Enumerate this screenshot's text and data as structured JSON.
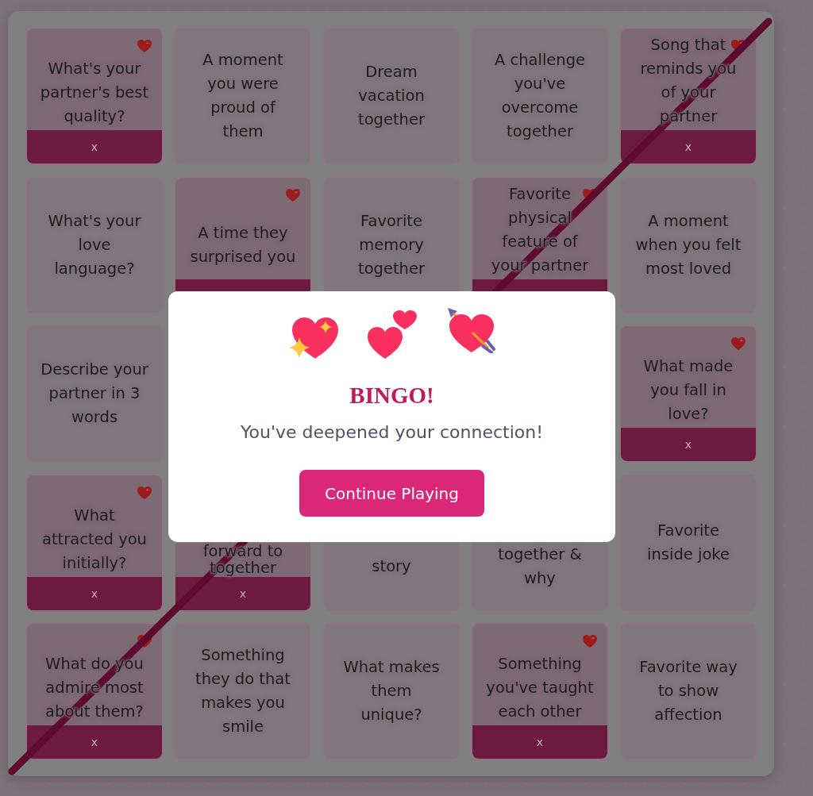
{
  "board": {
    "winning_line": {
      "kind": "anti_diagonal"
    },
    "rows": [
      {
        "cells": [
          {
            "kind": "card",
            "text": "What's your\npartner's best\nquality?",
            "marked": true,
            "remove_label": "x"
          },
          {
            "kind": "card",
            "text": "A moment\nyou were\nproud of\nthem",
            "marked": false
          },
          {
            "kind": "card",
            "text": "Dream\nvacation\ntogether",
            "marked": false
          },
          {
            "kind": "card",
            "text": "A challenge\nyou've\novercome\ntogether",
            "marked": false
          },
          {
            "kind": "card",
            "text": "Song that\nreminds you\nof your\npartner",
            "marked": true,
            "remove_label": "x"
          }
        ]
      },
      {
        "cells": [
          {
            "kind": "card",
            "text": "What's your\nlove\nlanguage?",
            "marked": false
          },
          {
            "kind": "card",
            "text": "A time they\nsurprised you",
            "marked": true
          },
          {
            "kind": "card",
            "text": "Favorite\nmemory\ntogether",
            "marked": false
          },
          {
            "kind": "card",
            "text": "Favorite\nphysical\nfeature of\nyour partner",
            "marked": true
          },
          {
            "kind": "card",
            "text": "A moment\nwhen you felt\nmost loved",
            "marked": false
          }
        ]
      },
      {
        "cells": [
          {
            "kind": "card",
            "text": "Describe your\npartner in 3\nwords",
            "marked": false
          },
          {
            "kind": "covered"
          },
          {
            "kind": "covered"
          },
          {
            "kind": "covered"
          },
          {
            "kind": "card",
            "text": "What made\nyou fall in\nlove?",
            "marked": true,
            "remove_label": "x"
          }
        ]
      },
      {
        "cells": [
          {
            "kind": "card",
            "text": "What\nattracted you\ninitially?",
            "marked": true,
            "remove_label": "x"
          },
          {
            "kind": "cut",
            "text": "forward to\ntogether",
            "marked": true,
            "remove_label": "x"
          },
          {
            "kind": "cut",
            "text": "story",
            "marked": false
          },
          {
            "kind": "cut",
            "text": "together &\nwhy",
            "marked": false
          },
          {
            "kind": "card",
            "text": "Favorite\ninside joke",
            "marked": false
          }
        ]
      },
      {
        "cells": [
          {
            "kind": "card",
            "text": "What do you\nadmire most\nabout them?",
            "marked": true,
            "remove_label": "x"
          },
          {
            "kind": "card",
            "text": "Something\nthey do that\nmakes you\nsmile",
            "marked": false
          },
          {
            "kind": "card",
            "text": "What makes\nthem\nunique?",
            "marked": false
          },
          {
            "kind": "card",
            "text": "Something\nyou've taught\neach other",
            "marked": true,
            "remove_label": "x"
          },
          {
            "kind": "card",
            "text": "Favorite way\nto show\naffection",
            "marked": false
          }
        ]
      }
    ]
  },
  "dialog": {
    "title": "BINGO!",
    "message": "You've deepened your connection!",
    "button": "Continue Playing"
  }
}
